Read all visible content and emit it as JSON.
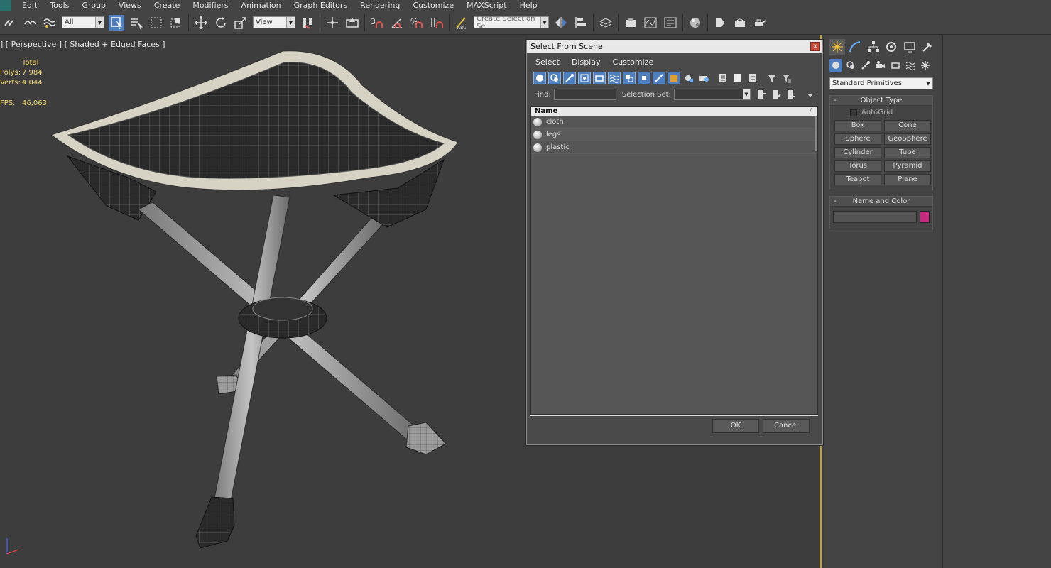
{
  "menubar": {
    "items": [
      "Edit",
      "Tools",
      "Group",
      "Views",
      "Create",
      "Modifiers",
      "Animation",
      "Graph Editors",
      "Rendering",
      "Customize",
      "MAXScript",
      "Help"
    ]
  },
  "toolbar": {
    "filter_value": "All",
    "refcoord_value": "View",
    "named_selection_placeholder": "Create Selection Se"
  },
  "viewport": {
    "label": "] [ Perspective ] [ Shaded + Edged Faces ]",
    "stats": {
      "total_label": "Total",
      "polys_label": "Polys:",
      "polys_value": "7 984",
      "verts_label": "Verts:",
      "verts_value": "4 044",
      "fps_label": "FPS:",
      "fps_value": "46,063"
    },
    "axis": {
      "x": "x",
      "z": "z"
    }
  },
  "dialog": {
    "title": "Select From Scene",
    "close": "x",
    "menu": [
      "Select",
      "Display",
      "Customize"
    ],
    "find_label": "Find:",
    "selection_set_label": "Selection Set:",
    "column_name": "Name",
    "sort_indicator": "/",
    "objects": [
      {
        "name": "cloth"
      },
      {
        "name": "legs"
      },
      {
        "name": "plastic"
      }
    ],
    "ok_label": "OK",
    "cancel_label": "Cancel"
  },
  "command_panel": {
    "category": "Standard Primitives",
    "object_type": {
      "title": "Object Type",
      "collapse": "-",
      "autogrid": "AutoGrid",
      "buttons": [
        "Box",
        "Cone",
        "Sphere",
        "GeoSphere",
        "Cylinder",
        "Tube",
        "Torus",
        "Pyramid",
        "Teapot",
        "Plane"
      ]
    },
    "name_and_color": {
      "title": "Name and Color",
      "collapse": "-",
      "color": "#c52a7e"
    }
  },
  "colors": {
    "accent": "#4f7fbf",
    "stats": "#f4d96a",
    "viewport_border": "#c8a030"
  }
}
